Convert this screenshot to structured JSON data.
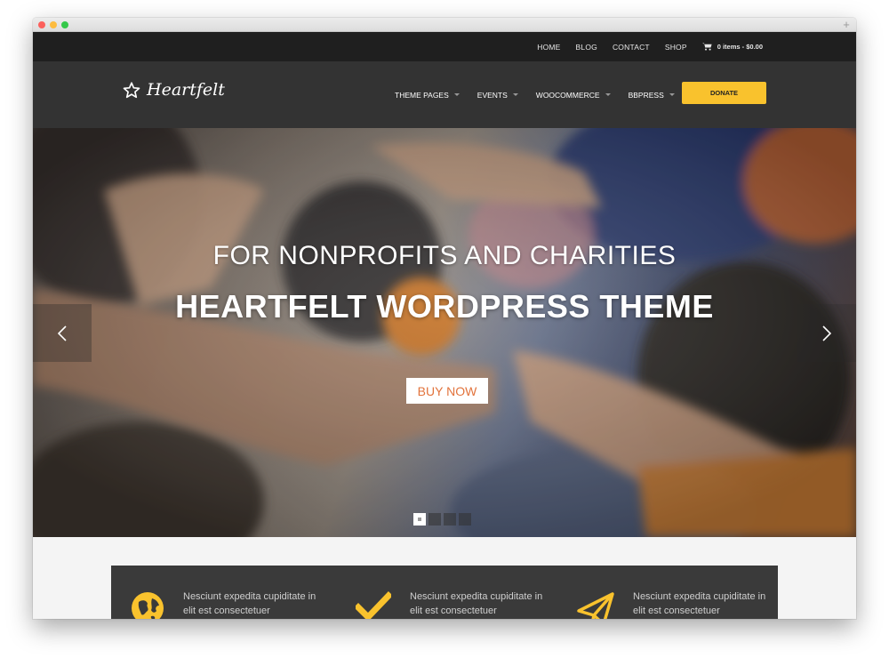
{
  "colors": {
    "accent": "#f9c22d",
    "topbar": "#1f1f1f",
    "header": "#333333",
    "buy_text": "#e2733c"
  },
  "topnav": {
    "items": [
      "HOME",
      "BLOG",
      "CONTACT",
      "SHOP"
    ],
    "cart_label": "0 items - $0.00",
    "cart_icon": "cart-icon"
  },
  "header": {
    "logo_text": "Heartfelt",
    "logo_icon": "star-icon",
    "nav": [
      "THEME PAGES",
      "EVENTS",
      "WOOCOMMERCE",
      "BBPRESS"
    ],
    "donate_label": "DONATE"
  },
  "hero": {
    "subtitle": "FOR NONPROFITS AND CHARITIES",
    "title": "HEARTFELT WORDPRESS THEME",
    "cta": "BUY NOW",
    "slides_total": 4,
    "slide_active": 1
  },
  "features": [
    {
      "icon": "globe-icon",
      "line1": "Nesciunt expedita cupiditate in",
      "line2": "elit est consectetuer"
    },
    {
      "icon": "check-icon",
      "line1": "Nesciunt expedita cupiditate in",
      "line2": "elit est consectetuer"
    },
    {
      "icon": "paper-plane-icon",
      "line1": "Nesciunt expedita cupiditate in",
      "line2": "elit est consectetuer"
    }
  ]
}
